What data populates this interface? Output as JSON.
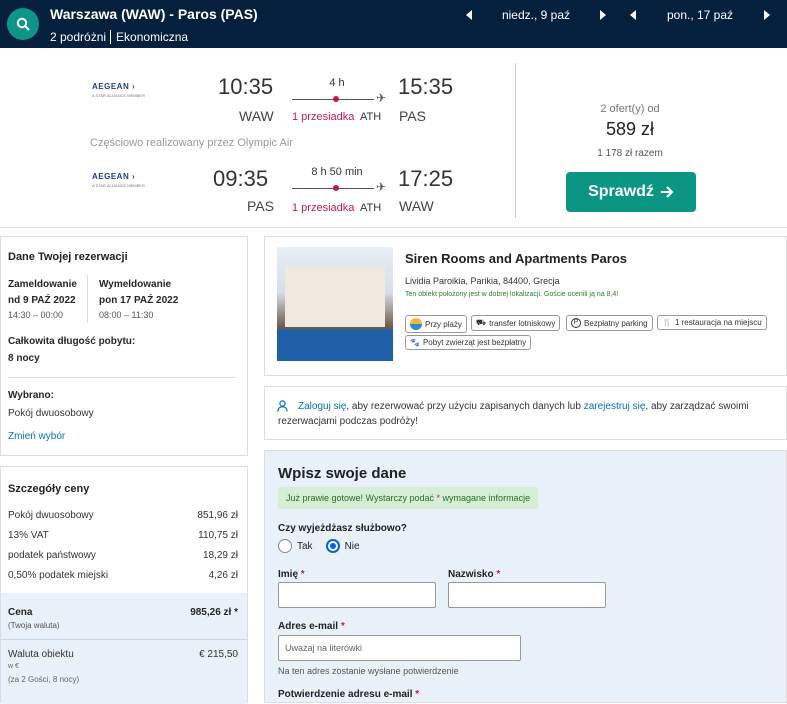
{
  "search": {
    "route": "Warszawa (WAW) - Paros (PAS)",
    "travellers": "2 podróżni",
    "cabin": "Ekonomiczna",
    "depart_date": "niedz., 9 paź",
    "return_date": "pon., 17 paź",
    "icon": "search-icon"
  },
  "flights": {
    "outbound": {
      "airline": "AEGEAN",
      "alliance": "A STAR ALLIANCE MEMBER",
      "dep_time": "10:35",
      "dep_code": "WAW",
      "duration": "4 h",
      "stops": "1 przesiadka",
      "via": "ATH",
      "arr_time": "15:35",
      "arr_code": "PAS"
    },
    "operated_by": "Częściowo realizowany przez Olympic Air",
    "inbound": {
      "airline": "AEGEAN",
      "alliance": "A STAR ALLIANCE MEMBER",
      "dep_time": "09:35",
      "dep_code": "PAS",
      "duration": "8 h 50 min",
      "stops": "1 przesiadka",
      "via": "ATH",
      "arr_time": "17:25",
      "arr_code": "WAW"
    },
    "offers_count": "2 ofert(y) od",
    "price": "589 zł",
    "total": "1 178 zł razem",
    "check_button": "Sprawdź",
    "check_icon": "arrow-right-icon"
  },
  "booking": {
    "title": "Dane Twojej rezerwacji",
    "checkin_label": "Zameldowanie",
    "checkin_date": "nd 9 PAŹ 2022",
    "checkin_time": "14:30 – 00:00",
    "checkout_label": "Wymeldowanie",
    "checkout_date": "pon 17 PAŹ 2022",
    "checkout_time": "08:00 – 11:30",
    "stay_label": "Całkowita długość pobytu:",
    "stay_value": "8 nocy",
    "selected_label": "Wybrano:",
    "selected_value": "Pokój dwuosobowy",
    "change_link": "Zmień wybór"
  },
  "price_details": {
    "title": "Szczegóły ceny",
    "rows": [
      {
        "label": "Pokój dwuosobowy",
        "value": "851,96 zł"
      },
      {
        "label": "13% VAT",
        "value": "110,75 zł"
      },
      {
        "label": "podatek państwowy",
        "value": "18,29 zł"
      },
      {
        "label": "0,50% podatek miejski",
        "value": "4,26 zł"
      }
    ],
    "total_label": "Cena",
    "total_sub": "(Twoja waluta)",
    "total_value": "985,26 zł *",
    "currency_label": "Waluta obiektu",
    "currency_sub1": "w €",
    "currency_sub2": "(za 2 Gości, 8 nocy)",
    "currency_value": "€ 215,50"
  },
  "hotel": {
    "name": "Siren Rooms and Apartments Paros",
    "address": "Lividia Paroikia, Parikia, 84400, Grecja",
    "note": "Ten obiekt położony jest w dobrej lokalizacji. Goście ocenili ją na 8,4!",
    "amenities": [
      {
        "label": "Przy plaży",
        "icon": "beach-icon"
      },
      {
        "label": "transfer lotniskowy",
        "icon": "shuttle-icon"
      },
      {
        "label": "Bezpłatny parking",
        "icon": "parking-icon"
      },
      {
        "label": "1 restauracja na miejscu",
        "icon": "restaurant-icon"
      },
      {
        "label": "Pobyt zwierząt jest bezpłatny",
        "icon": "pet-icon"
      }
    ]
  },
  "login": {
    "icon": "user-icon",
    "login_link": "Zaloguj się",
    "text1": ", aby rezerwować przy użyciu zapisanych danych lub",
    "register_link": "zarejestruj się",
    "text2": ", aby zarządzać swoimi",
    "text3": "rezerwacjami podczas podróży!"
  },
  "form": {
    "title": "Wpisz swoje dane",
    "notice": "Już prawie gotowe! Wystarczy podać",
    "notice_star": "*",
    "notice_end": "wymagane informacje",
    "business_q": "Czy wyjeżdżasz służbowo?",
    "opt_yes": "Tak",
    "opt_no": "Nie",
    "first_name": "Imię",
    "last_name": "Nazwisko",
    "email_label": "Adres e-mail",
    "email_placeholder": "Uważaj na literówki",
    "email_hint": "Na ten adres zostanie wysłane potwierdzenie",
    "confirm_email": "Potwierdzenie adresu e-mail",
    "star": "*"
  }
}
